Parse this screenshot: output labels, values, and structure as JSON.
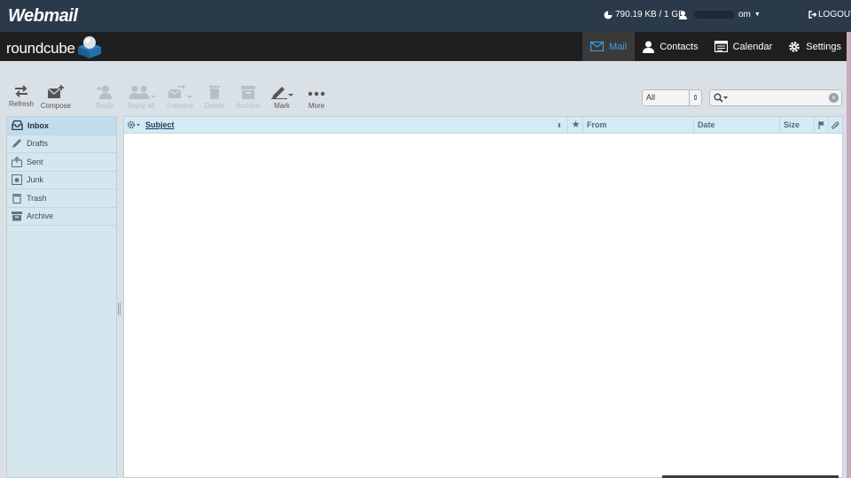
{
  "topbar": {
    "brand": "Webmail",
    "quota": "790.19 KB / 1 GB",
    "user_prefix": "",
    "user_suffix": "om",
    "logout": "LOGOUT"
  },
  "header": {
    "logo": "roundcube",
    "nav": [
      {
        "label": "Mail",
        "icon": "mail-icon",
        "active": true
      },
      {
        "label": "Contacts",
        "icon": "contacts-icon"
      },
      {
        "label": "Calendar",
        "icon": "calendar-icon"
      },
      {
        "label": "Settings",
        "icon": "gear-icon"
      }
    ]
  },
  "toolbar": {
    "refresh": "Refresh",
    "compose": "Compose",
    "reply": "Reply",
    "reply_all": "Reply all",
    "forward": "Forward",
    "delete": "Delete",
    "archive": "Archive",
    "mark": "Mark",
    "more": "More",
    "filter_value": "All",
    "search_placeholder": ""
  },
  "folders": [
    {
      "label": "Inbox",
      "icon": "inbox-icon",
      "active": true
    },
    {
      "label": "Drafts",
      "icon": "pencil-icon"
    },
    {
      "label": "Sent",
      "icon": "sent-icon"
    },
    {
      "label": "Junk",
      "icon": "junk-icon"
    },
    {
      "label": "Trash",
      "icon": "trash-icon"
    },
    {
      "label": "Archive",
      "icon": "archive-icon"
    }
  ],
  "message_list": {
    "columns": {
      "subject": "Subject",
      "from": "From",
      "date": "Date",
      "size": "Size"
    },
    "rows": []
  },
  "colors": {
    "topbar": "#2b3a4a",
    "rcbar": "#1f1f1f",
    "accent": "#3ea0e6",
    "folder_bg": "#d5e6ef",
    "list_header": "#d6eaf4"
  }
}
